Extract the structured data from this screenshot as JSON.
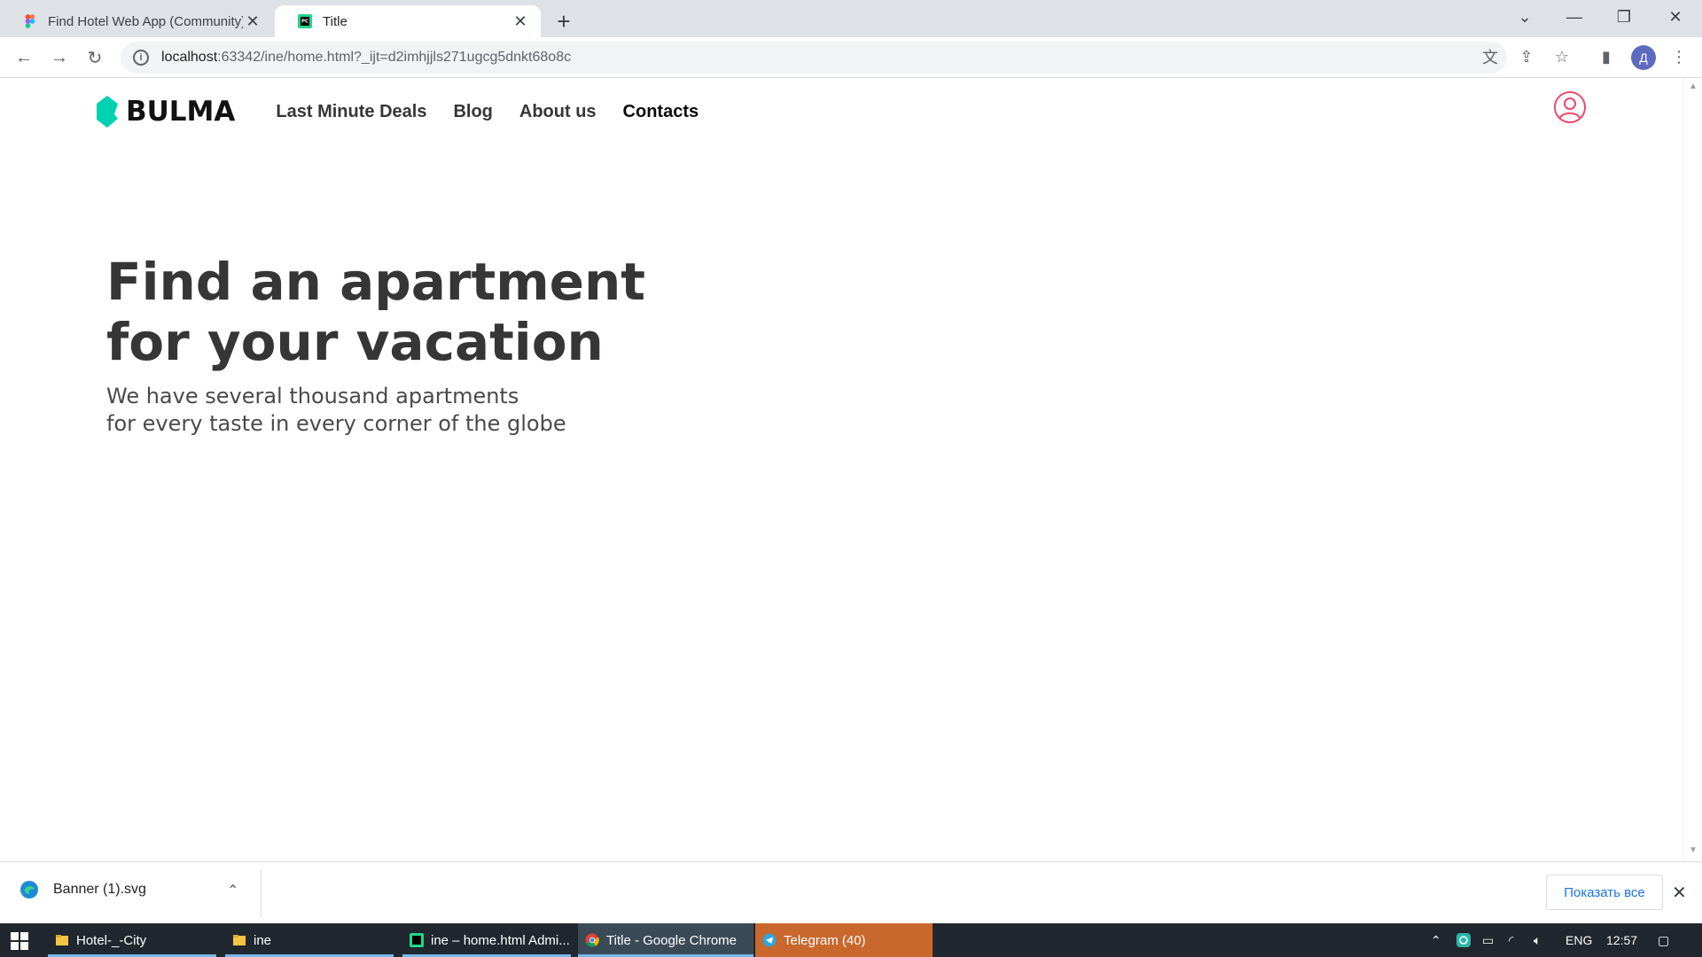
{
  "browser": {
    "tabs": [
      {
        "title": "Find Hotel Web App (Community)",
        "active": false
      },
      {
        "title": "Title",
        "active": true
      }
    ],
    "url_host": "localhost",
    "url_rest": ":63342/ine/home.html?_ijt=d2imhjjls271ugcg5dnkt68o8c",
    "profile_initial": "Д"
  },
  "navbar": {
    "brand": "BULMA",
    "items": [
      "Last Minute Deals",
      "Blog",
      "About us",
      "Contacts"
    ],
    "brand_color": "#00d1b2",
    "user_icon_color": "#f14668"
  },
  "hero": {
    "title_line1": "Find an apartment",
    "title_line2": "for your vacation",
    "subtitle_line1": "We have several thousand apartments",
    "subtitle_line2": "for every taste in every corner of the globe"
  },
  "downloads": {
    "file": "Banner (1).svg",
    "show_all": "Показать все"
  },
  "taskbar": {
    "apps": [
      {
        "label": "Hotel-_-City"
      },
      {
        "label": "ine"
      },
      {
        "label": "ine – home.html Admi..."
      },
      {
        "label": "Title - Google Chrome"
      },
      {
        "label": "Telegram (40)"
      }
    ],
    "lang": "ENG",
    "time": "12:57"
  }
}
